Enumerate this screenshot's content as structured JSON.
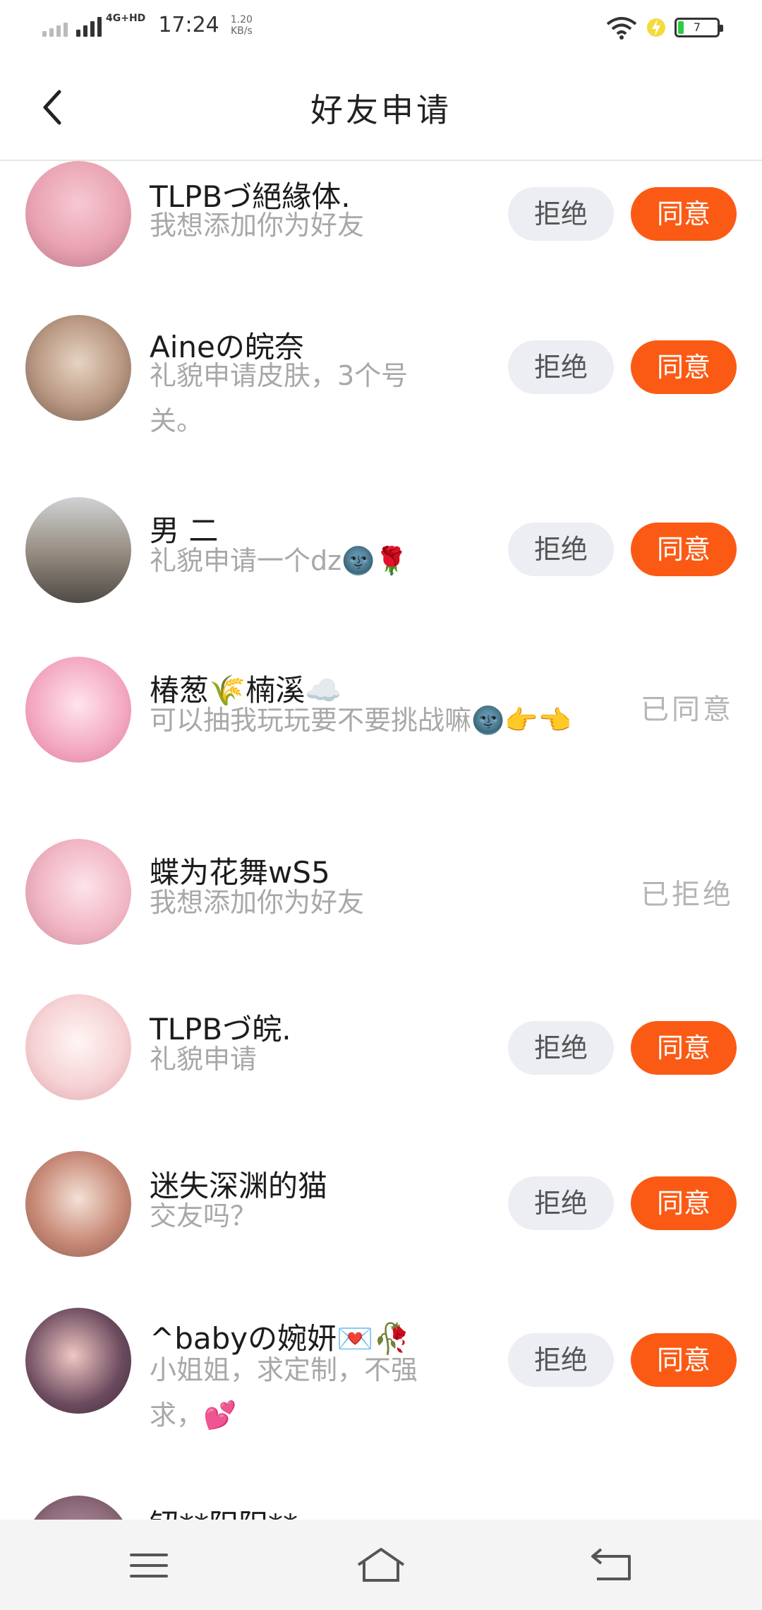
{
  "status": {
    "network": "4G+HD",
    "time": "17:24",
    "speed_value": "1.20",
    "speed_unit": "KB/s",
    "battery": "7"
  },
  "header": {
    "title": "好友申请"
  },
  "buttons": {
    "reject": "拒绝",
    "agree": "同意"
  },
  "items": [
    {
      "name": "TLPBづ絕緣体.",
      "message": "我想添加你为好友",
      "state": "pending",
      "avatar_color": "#e9a3b3"
    },
    {
      "name": "Aineの皖奈",
      "message": "礼貌申请皮肤，3个号关。",
      "state": "pending",
      "avatar_color": "#b99883"
    },
    {
      "name": "男  二",
      "message": "礼貌申请一个dz🌚🌹",
      "state": "pending",
      "avatar_color": "#9a8f84"
    },
    {
      "name": "椿葱🌾楠溪☁️",
      "message": "可以抽我玩玩要不要挑战嘛🌚👉👈",
      "state": "done",
      "state_label": "已同意",
      "avatar_color": "#f3a7c0"
    },
    {
      "name": "蝶为花舞wS5",
      "message": "我想添加你为好友",
      "state": "done",
      "state_label": "已拒绝",
      "avatar_color": "#f1b6c4"
    },
    {
      "name": "TLPBづ皖.",
      "message": "礼貌申请",
      "state": "pending",
      "avatar_color": "#f6d3d6"
    },
    {
      "name": "迷失深渊的猫",
      "message": "交友吗？",
      "state": "pending",
      "avatar_color": "#c98b79"
    },
    {
      "name": "^babyの婉妍💌🥀",
      "message": "小姐姐，求定制，不强求，💕",
      "state": "pending",
      "avatar_color": "#6b4a5e"
    },
    {
      "name": "钮**阳阳**",
      "message": "",
      "state": "pending",
      "avatar_color": "#8d6a7a"
    }
  ],
  "colors": {
    "accent": "#fb5a14",
    "reject_bg": "#eceef3"
  },
  "icons": {
    "back": "chevron-left-icon",
    "menu": "menu-icon",
    "home": "home-icon",
    "return": "return-icon"
  }
}
